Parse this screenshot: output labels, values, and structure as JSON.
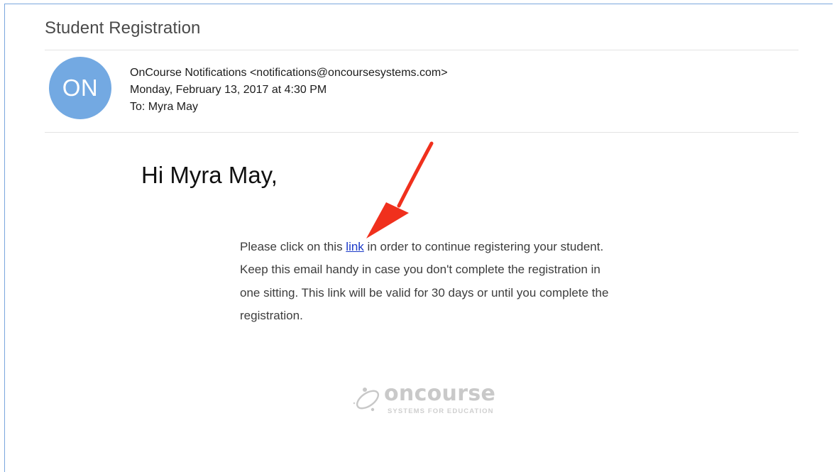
{
  "email": {
    "subject": "Student Registration",
    "avatar_initials": "ON",
    "sender": "OnCourse Notifications <notifications@oncoursesystems.com>",
    "date": "Monday, February 13, 2017 at 4:30 PM",
    "to": "To: Myra May"
  },
  "message": {
    "greeting": "Hi Myra May,",
    "text_before_link": "Please click on this ",
    "link_text": "link",
    "text_after_link": " in order to continue registering your student. Keep this email handy in case you don't complete the registration in one sitting. This link will be valid for 30 days or until you complete the registration."
  },
  "logo": {
    "name": "oncourse",
    "tagline": "SYSTEMS FOR EDUCATION"
  },
  "colors": {
    "avatar": "#73a9e2",
    "link": "#1a39c8",
    "annotation_arrow": "#f0301d",
    "frame_border": "#7aa7dd"
  },
  "icons": {
    "annotation": "red-arrow-icon",
    "logo_mark": "oncourse-logo-mark-icon"
  }
}
